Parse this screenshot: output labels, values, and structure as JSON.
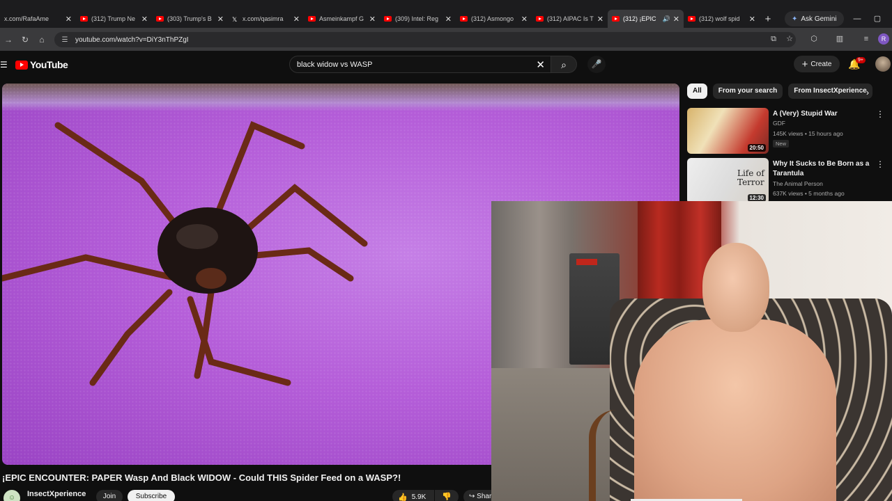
{
  "browser": {
    "tabs": [
      {
        "label": "x.com/RafaAme",
        "icon": "none"
      },
      {
        "label": "(312) Trump Ne",
        "icon": "youtube"
      },
      {
        "label": "(303) Trump's B",
        "icon": "youtube"
      },
      {
        "label": "x.com/qasimra",
        "icon": "x"
      },
      {
        "label": "Asmeinkampf G",
        "icon": "youtube"
      },
      {
        "label": "(309) Intel: Reg",
        "icon": "youtube"
      },
      {
        "label": "(312) Asmongo",
        "icon": "youtube"
      },
      {
        "label": "(312) AIPAC Is T",
        "icon": "youtube"
      },
      {
        "label": "(312) ¡EPIC",
        "icon": "youtube",
        "active": true
      },
      {
        "label": "(312) wolf spid",
        "icon": "youtube"
      }
    ],
    "ask_gemini": "Ask Gemini",
    "url": "youtube.com/watch?v=DiY3nThPZgI",
    "profile_initial": "R"
  },
  "youtube": {
    "logo_text": "YouTube",
    "search_value": "black widow vs WASP",
    "create_label": "Create",
    "notification_count": "9+"
  },
  "video": {
    "title": "¡EPIC ENCOUNTER: PAPER Wasp And Black WIDOW - Could THIS Spider Feed on a WASP?!",
    "channel": "InsectXperience",
    "join_label": "Join",
    "subscribe_label": "Subscribe",
    "likes": "5.9K",
    "share_label": "Share"
  },
  "sidebar": {
    "chips": [
      "All",
      "From your search",
      "From InsectXperience"
    ],
    "recommendations": [
      {
        "title": "A (Very) Stupid War",
        "channel": "GDF",
        "meta": "145K views • 15 hours ago",
        "badge": "New",
        "duration": "20:50"
      },
      {
        "title": "Why It Sucks to Be Born as a Tarantula",
        "channel": "The Animal Person",
        "meta": "637K views • 5 months ago",
        "duration": "12:30",
        "thumb_text": "Life of Terror"
      }
    ]
  },
  "colors": {
    "youtube_red": "#ff0000",
    "video_bg": "#b55ed9",
    "subscribe_bg": "#f1f1f1"
  }
}
